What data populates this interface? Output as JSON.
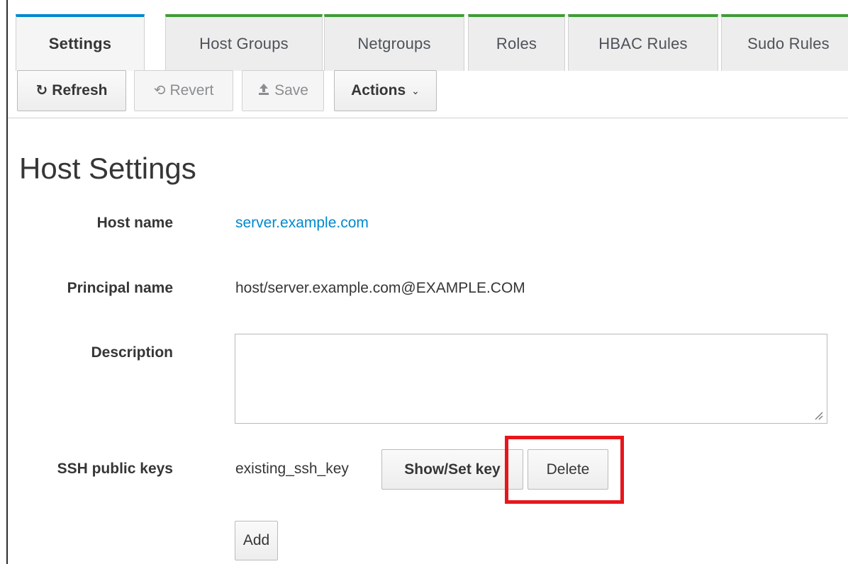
{
  "tabs": [
    {
      "label": "Settings",
      "active": true
    },
    {
      "label": "Host Groups"
    },
    {
      "label": "Netgroups"
    },
    {
      "label": "Roles"
    },
    {
      "label": "HBAC Rules"
    },
    {
      "label": "Sudo Rules"
    }
  ],
  "toolbar": {
    "refresh": "Refresh",
    "revert": "Revert",
    "save": "Save",
    "actions": "Actions"
  },
  "page_title": "Host Settings",
  "fields": {
    "host_name_label": "Host name",
    "host_name_value": "server.example.com",
    "principal_label": "Principal name",
    "principal_value": "host/server.example.com@EXAMPLE.COM",
    "description_label": "Description",
    "description_value": "",
    "ssh_label": "SSH public keys",
    "ssh_key_value": "existing_ssh_key",
    "show_set_key": "Show/Set key",
    "delete": "Delete",
    "add": "Add"
  },
  "icons": {
    "refresh": "refresh-icon",
    "revert": "undo-icon",
    "save": "upload-icon",
    "actions": "chevron-down-icon"
  },
  "colors": {
    "link": "#0088ce",
    "active_tab_accent": "#0088ce",
    "tab_accent": "#3f9c35",
    "highlight": "#e8161b"
  }
}
